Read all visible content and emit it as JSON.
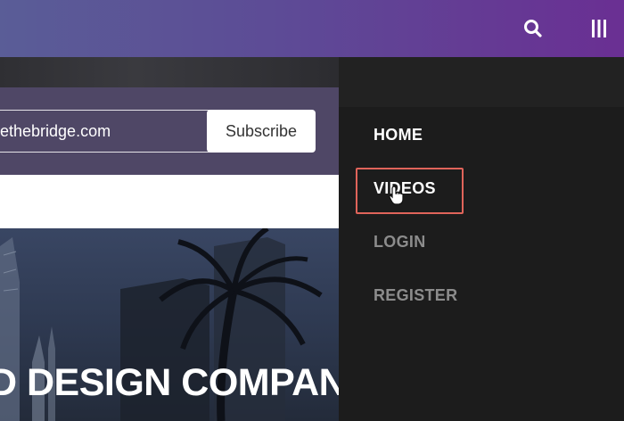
{
  "header": {
    "search_icon": "search-icon",
    "menu_icon": "menu-icon"
  },
  "subscribe": {
    "email_value": "ethebridge.com",
    "button_label": "Subscribe"
  },
  "hero": {
    "heading": "D DESIGN COMPANY"
  },
  "drawer": {
    "items": [
      {
        "label": "HOME",
        "state": "active"
      },
      {
        "label": "VIDEOS",
        "state": "hovered"
      },
      {
        "label": "LOGIN",
        "state": "normal"
      },
      {
        "label": "REGISTER",
        "state": "normal"
      }
    ]
  },
  "colors": {
    "header_start": "#5a5d97",
    "header_end": "#6a2f93",
    "drawer_bg": "#1c1c1c",
    "highlight": "#e0645a",
    "muted_nav": "#8c8c8c"
  }
}
